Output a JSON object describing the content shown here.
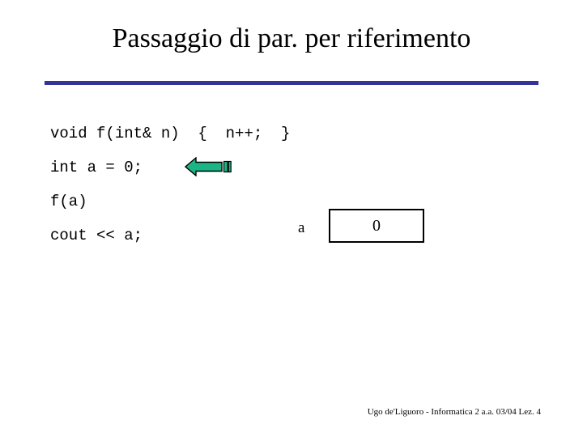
{
  "slide": {
    "title": "Passaggio di par. per riferimento",
    "rule_color": "#333399",
    "background_color": "#ffffff",
    "text_color": "#000000"
  },
  "code": {
    "lines": [
      "void f(int& n)  {  n++;  }",
      "int a = 0;",
      "f(a)",
      "cout << a;"
    ]
  },
  "arrow": {
    "name": "left-arrow",
    "direction": "left",
    "fill_color": "#1bb485",
    "outline_color": "#000000"
  },
  "variable": {
    "label": "a",
    "value": "0",
    "box_border_color": "#000000"
  },
  "footer": {
    "text": "Ugo de'Liguoro - Informatica 2 a.a. 03/04 Lez. 4"
  }
}
